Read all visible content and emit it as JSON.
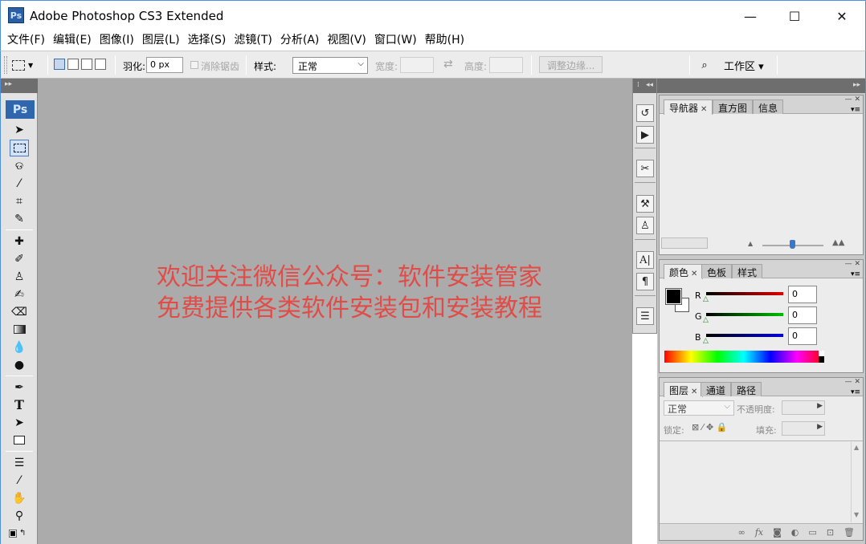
{
  "window": {
    "app_icon": "Ps",
    "title": "Adobe Photoshop CS3 Extended",
    "minimize_icon": "—",
    "maximize_icon": "☐",
    "close_icon": "✕"
  },
  "menubar": {
    "items": [
      "文件(F)",
      "编辑(E)",
      "图像(I)",
      "图层(L)",
      "选择(S)",
      "滤镜(T)",
      "分析(A)",
      "视图(V)",
      "窗口(W)",
      "帮助(H)"
    ]
  },
  "options_bar": {
    "feather_label": "羽化:",
    "feather_value": "0 px",
    "antialias_label": "消除锯齿",
    "style_label": "样式:",
    "style_value": "正常",
    "width_label": "宽度:",
    "height_label": "高度:",
    "refine_edge_label": "调整边缘...",
    "workspace_label": "工作区 ▾"
  },
  "toolbox": {
    "logo": "Ps"
  },
  "canvas": {
    "watermark_line1": "欢迎关注微信公众号：软件安装管家",
    "watermark_line2": "免费提供各类软件安装包和安装教程",
    "watermark_color": "#e04c47",
    "background_color": "#ababab"
  },
  "panels": {
    "navigator_group": {
      "tabs": [
        "导航器",
        "直方图",
        "信息"
      ],
      "active_tab": "导航器"
    },
    "color_group": {
      "tabs": [
        "颜色",
        "色板",
        "样式"
      ],
      "active_tab": "颜色",
      "channels": [
        {
          "name": "R",
          "value": "0",
          "color": "#e00000"
        },
        {
          "name": "G",
          "value": "0",
          "color": "#00c000"
        },
        {
          "name": "B",
          "value": "0",
          "color": "#0000e0"
        }
      ]
    },
    "layers_group": {
      "tabs": [
        "图层",
        "通道",
        "路径"
      ],
      "active_tab": "图层",
      "blend_mode": "正常",
      "opacity_label": "不透明度:",
      "lock_label": "锁定:",
      "fill_label": "填充:"
    }
  }
}
